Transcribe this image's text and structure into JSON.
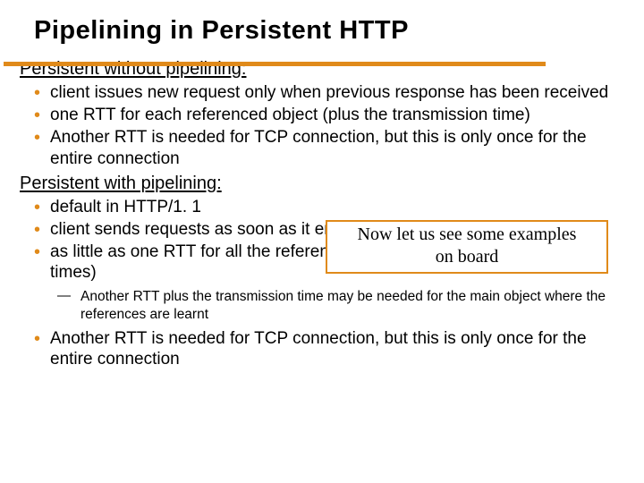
{
  "title": "Pipelining in Persistent HTTP",
  "section1": {
    "heading": "Persistent without pipelining:",
    "items": [
      "client issues new request only when previous response has been received",
      "one RTT for each referenced object (plus the transmission time)",
      "Another RTT is needed for TCP connection, but this is only once for the entire connection"
    ]
  },
  "section2": {
    "heading": "Persistent with pipelining:",
    "items": [
      "default in HTTP/1. 1",
      "client sends requests as soon as it encounters a referenced object",
      "as little as one RTT for all the referenced objects (plus the transmission times)"
    ],
    "subitem": "Another RTT plus the transmission time may be needed for the main object where the references are learnt",
    "item4": "Another RTT is needed for TCP connection, but this is only once for the entire connection"
  },
  "callout": {
    "line1": "Now let us see some examples",
    "line2": "on board"
  }
}
